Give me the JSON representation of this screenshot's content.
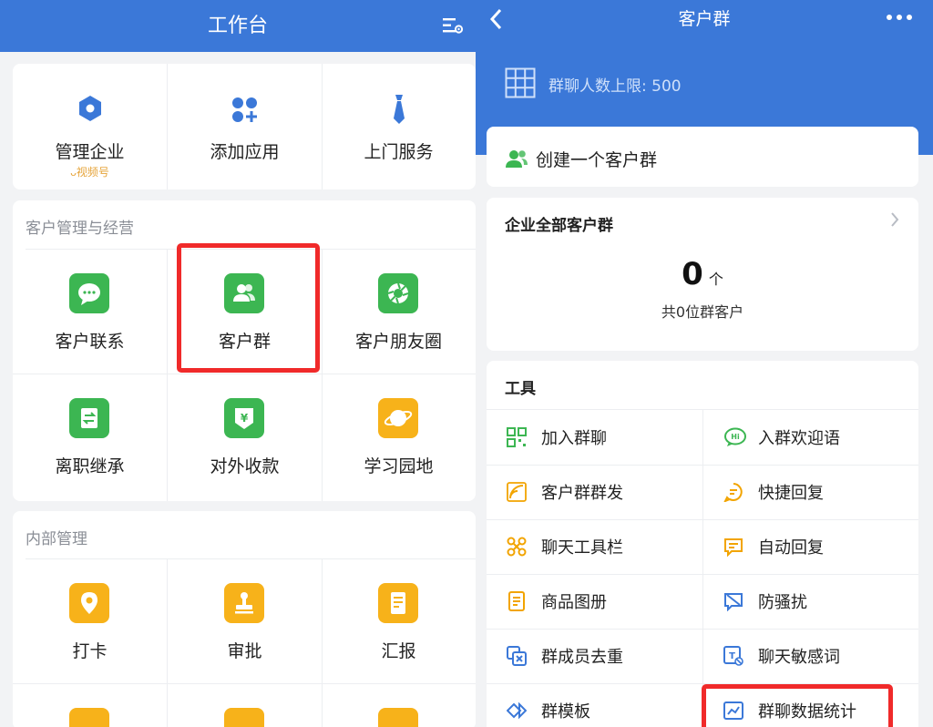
{
  "left_screen": {
    "header": {
      "title": "工作台",
      "settings_icon": "settings-list-icon"
    },
    "top_apps": [
      {
        "label": "管理企业",
        "icon": "hexagon-icon",
        "badge": "视频号"
      },
      {
        "label": "添加应用",
        "icon": "add-apps-icon"
      },
      {
        "label": "上门服务",
        "icon": "tie-icon"
      }
    ],
    "sections": [
      {
        "title": "客户管理与经营",
        "items": [
          {
            "label": "客户联系",
            "icon": "chat-bubble-icon",
            "color": "#3cb652"
          },
          {
            "label": "客户群",
            "icon": "customer-group-icon",
            "color": "#3cb652",
            "highlighted": true
          },
          {
            "label": "客户朋友圈",
            "icon": "moments-icon",
            "color": "#3cb652"
          },
          {
            "label": "离职继承",
            "icon": "transfer-icon",
            "color": "#3cb652"
          },
          {
            "label": "对外收款",
            "icon": "payment-icon",
            "color": "#3cb652"
          },
          {
            "label": "学习园地",
            "icon": "planet-icon",
            "color": "#f7b21a"
          }
        ]
      },
      {
        "title": "内部管理",
        "items": [
          {
            "label": "打卡",
            "icon": "location-pin-icon",
            "color": "#f7b21a"
          },
          {
            "label": "审批",
            "icon": "stamp-icon",
            "color": "#f7b21a"
          },
          {
            "label": "汇报",
            "icon": "report-icon",
            "color": "#f7b21a"
          }
        ]
      }
    ]
  },
  "right_screen": {
    "header": {
      "title": "客户群",
      "back_icon": "chevron-left-icon",
      "more_icon": "more-dots-icon"
    },
    "limit_text": "群聊人数上限: 500",
    "create_group": "创建一个客户群",
    "all_groups": {
      "title": "企业全部客户群",
      "count": "0",
      "unit": "个",
      "subtitle": "共0位群客户"
    },
    "tools": {
      "title": "工具",
      "items": [
        {
          "label": "加入群聊",
          "icon": "qrcode-icon",
          "color": "#3cb652"
        },
        {
          "label": "入群欢迎语",
          "icon": "welcome-hi-icon",
          "color": "#3cb652"
        },
        {
          "label": "客户群群发",
          "icon": "broadcast-icon",
          "color": "#f2a400"
        },
        {
          "label": "快捷回复",
          "icon": "quick-reply-icon",
          "color": "#f2a400"
        },
        {
          "label": "聊天工具栏",
          "icon": "toolbar-icon",
          "color": "#f2a400"
        },
        {
          "label": "自动回复",
          "icon": "auto-reply-icon",
          "color": "#f2a400"
        },
        {
          "label": "商品图册",
          "icon": "catalog-icon",
          "color": "#f2a400"
        },
        {
          "label": "防骚扰",
          "icon": "anti-harass-icon",
          "color": "#3b78d8"
        },
        {
          "label": "群成员去重",
          "icon": "dedupe-icon",
          "color": "#3b78d8"
        },
        {
          "label": "聊天敏感词",
          "icon": "sensitive-word-icon",
          "color": "#3b78d8"
        },
        {
          "label": "群模板",
          "icon": "template-icon",
          "color": "#3b78d8"
        },
        {
          "label": "群聊数据统计",
          "icon": "stats-icon",
          "color": "#3b78d8",
          "highlighted": true
        }
      ]
    }
  },
  "colors": {
    "brand_blue": "#3b78d8",
    "highlight_red": "#f02a2a",
    "green": "#3cb652",
    "orange": "#f7b21a"
  }
}
